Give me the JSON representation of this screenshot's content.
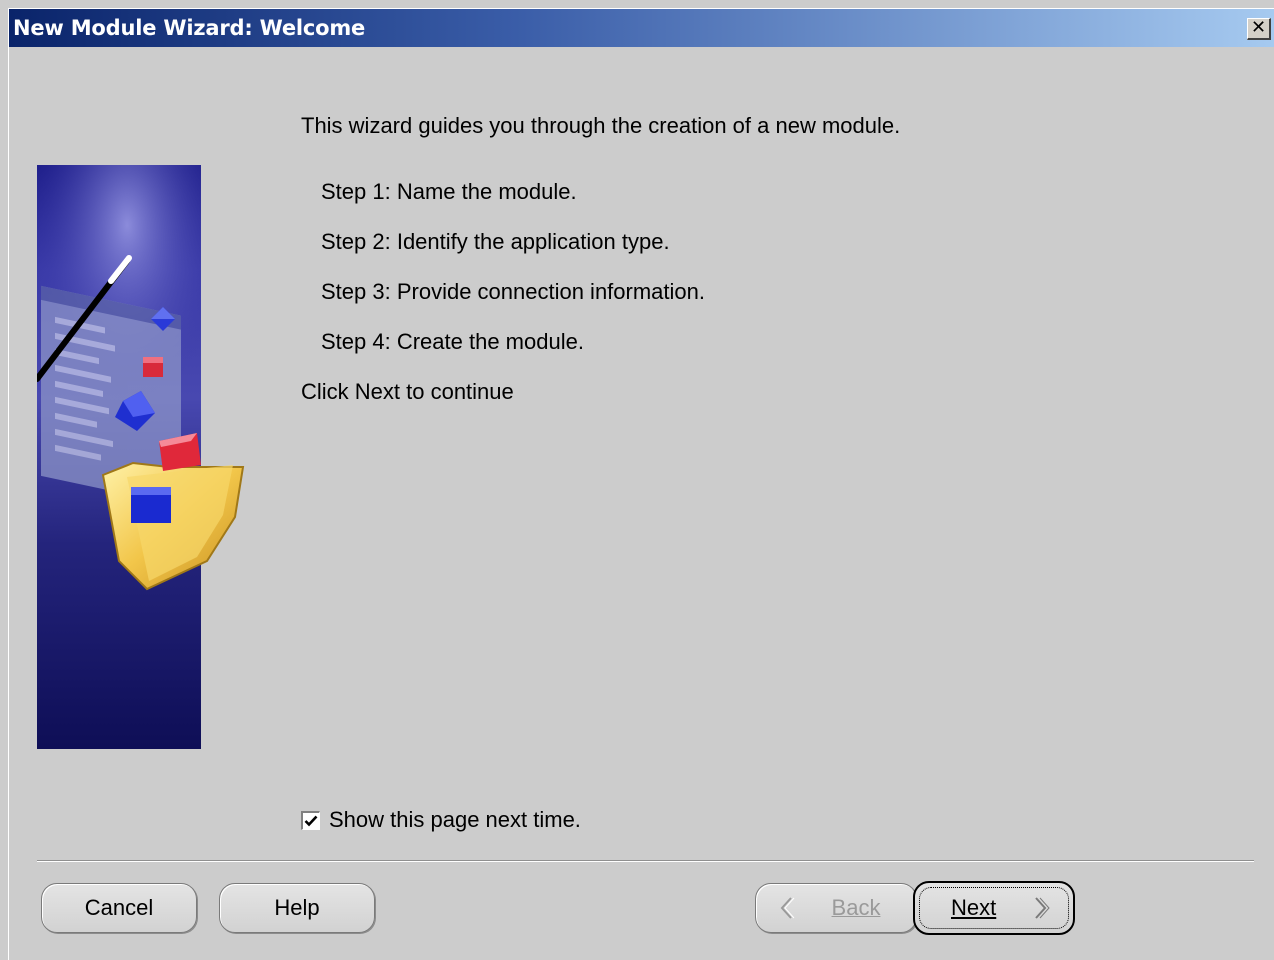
{
  "window": {
    "title": "New Module Wizard: Welcome",
    "close_symbol": "✕"
  },
  "content": {
    "intro": "This wizard guides you through the creation of a new module.",
    "steps": [
      "Step 1: Name the module.",
      "Step 2: Identify the application type.",
      "Step 3: Provide connection information.",
      "Step 4: Create the module."
    ],
    "continue_hint": "Click Next to continue",
    "banner_icon": "wizard-banner-illustration"
  },
  "options": {
    "show_page_label": "Show this page next time.",
    "show_page_checked": true
  },
  "buttons": {
    "cancel": "Cancel",
    "help": "Help",
    "back": "Back",
    "next": "Next",
    "back_enabled": false
  },
  "colors": {
    "titlebar_start": "#0a246a",
    "titlebar_end": "#a6caf0",
    "dialog_background": "#cccccc",
    "banner_blue": "#1a1a6e"
  }
}
